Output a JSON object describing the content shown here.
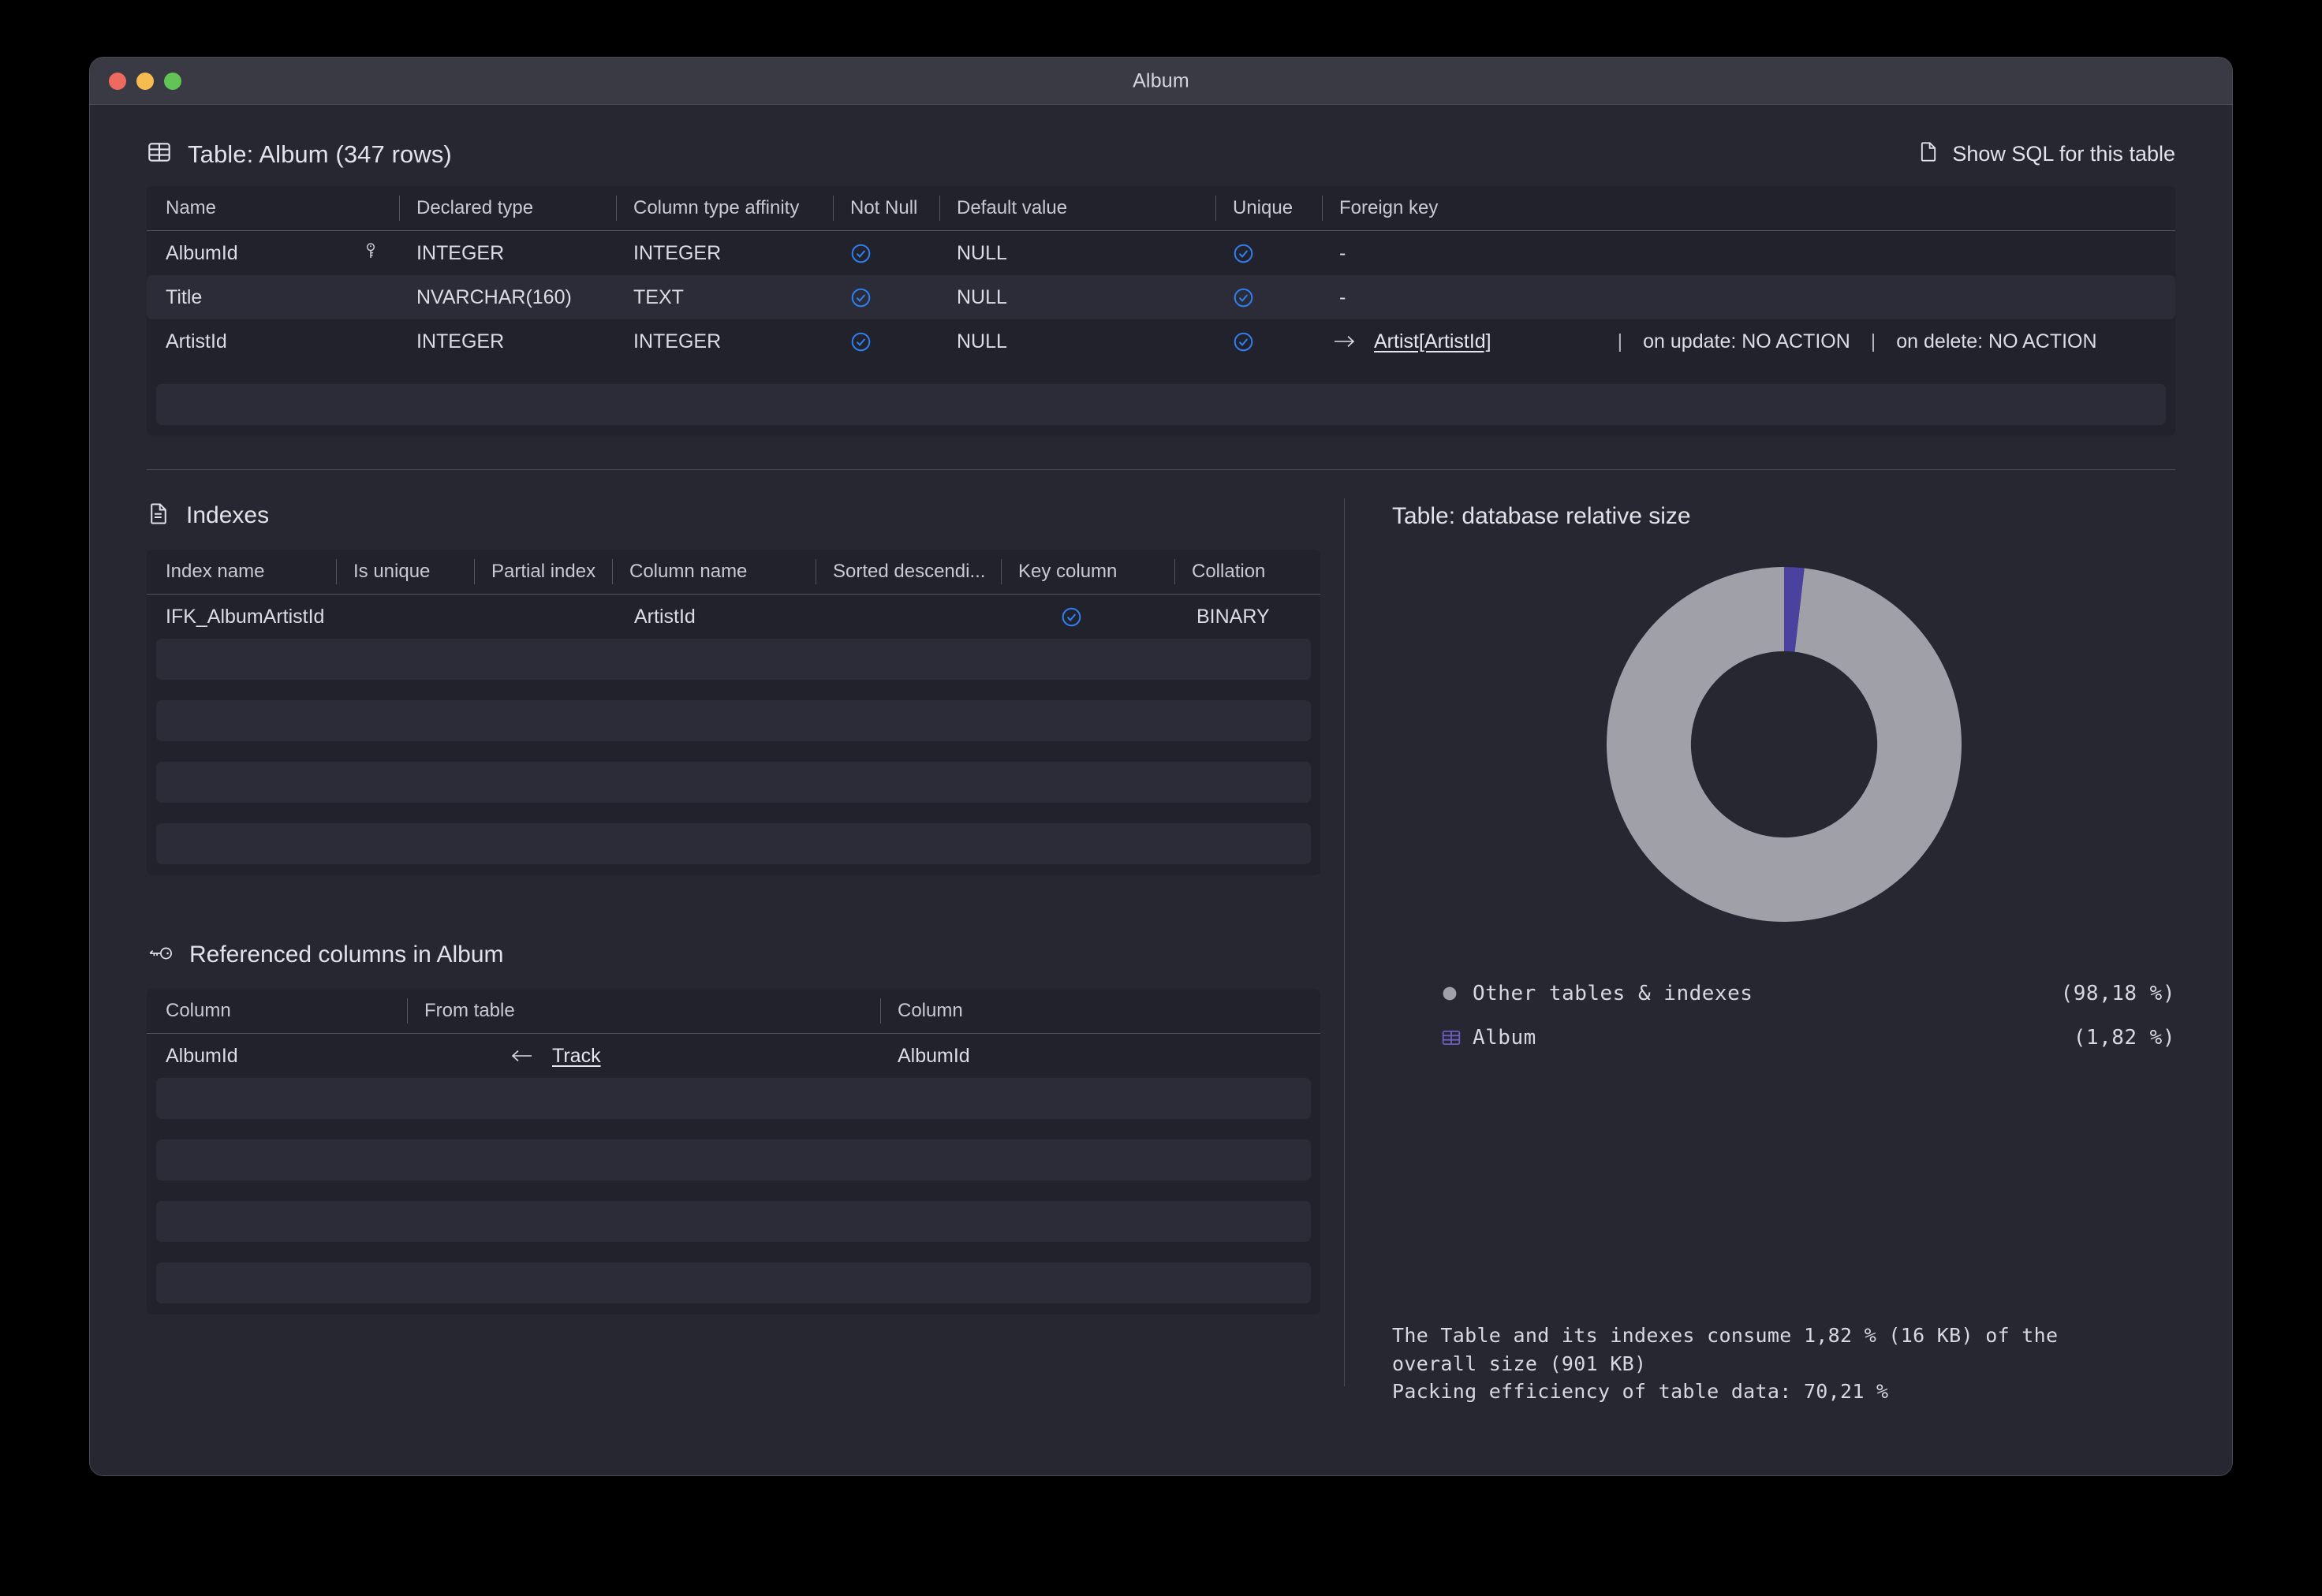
{
  "window": {
    "title": "Album"
  },
  "table_section": {
    "icon": "table-grid-icon",
    "title": "Table: Album (347 rows)",
    "show_sql_label": "Show SQL for this table",
    "show_sql_icon": "document-icon",
    "columns": [
      "Name",
      "Declared type",
      "Column type affinity",
      "Not Null",
      "Default value",
      "Unique",
      "Foreign key"
    ],
    "rows": [
      {
        "name": "AlbumId",
        "primary_key": true,
        "declared_type": "INTEGER",
        "affinity": "INTEGER",
        "not_null": true,
        "default_value": "NULL",
        "unique": true,
        "foreign_key": "-",
        "fk_target": "",
        "fk_on_update": "",
        "fk_on_delete": ""
      },
      {
        "name": "Title",
        "primary_key": false,
        "declared_type": "NVARCHAR(160)",
        "affinity": "TEXT",
        "not_null": true,
        "default_value": "NULL",
        "unique": true,
        "foreign_key": "-",
        "fk_target": "",
        "fk_on_update": "",
        "fk_on_delete": ""
      },
      {
        "name": "ArtistId",
        "primary_key": false,
        "declared_type": "INTEGER",
        "affinity": "INTEGER",
        "not_null": true,
        "default_value": "NULL",
        "unique": true,
        "foreign_key": "",
        "fk_target": "Artist[ArtistId]",
        "fk_on_update": "on update: NO ACTION",
        "fk_on_delete": "on delete: NO ACTION",
        "fk_separator": "|"
      }
    ]
  },
  "indexes_section": {
    "icon": "document-lines-icon",
    "title": "Indexes",
    "columns": [
      "Index name",
      "Is unique",
      "Partial index",
      "Column name",
      "Sorted descendi...",
      "Key column",
      "Collation"
    ],
    "rows": [
      {
        "index_name": "IFK_AlbumArtistId",
        "is_unique": "",
        "partial_index": "",
        "column_name": "ArtistId",
        "sorted_descending": "",
        "key_column": true,
        "collation": "BINARY"
      }
    ],
    "empty_row_count": 4
  },
  "referenced_section": {
    "icon": "key-horizontal-icon",
    "title": "Referenced columns in Album",
    "columns": [
      "Column",
      "From table",
      "Column"
    ],
    "rows": [
      {
        "column": "AlbumId",
        "arrow": "arrow-left-icon",
        "from_table": "Track",
        "target_column": "AlbumId"
      }
    ],
    "empty_row_count": 4
  },
  "size_section": {
    "title": "Table: database relative size",
    "legend": [
      {
        "icon": "circle-icon",
        "label": "Other tables & indexes",
        "percent": "(98,18 %)",
        "color": "#a0a0a8"
      },
      {
        "icon": "table-grid-icon",
        "label": "Album",
        "percent": "(1,82 %)",
        "color": "#4b42a0"
      }
    ],
    "summary_line1": "The Table and its indexes consume 1,82 % (16 KB) of the",
    "summary_line2": "overall size (901 KB)",
    "summary_line3": "Packing efficiency of table data: 70,21 %"
  },
  "chart_data": {
    "type": "pie",
    "title": "Table: database relative size",
    "donut": true,
    "labels": [
      "Other tables & indexes",
      "Album"
    ],
    "values": [
      98.18,
      1.82
    ],
    "value_labels": [
      "(98,18 %)",
      "(1,82 %)"
    ],
    "colors": [
      "#a0a0a8",
      "#4b42a0"
    ],
    "start_angle_deg": 0,
    "direction": "counterclockwise",
    "inner_radius_ratio": 0.525,
    "legend_position": "bottom",
    "units": "percent",
    "total_size": "901 KB",
    "table_size": "16 KB"
  },
  "colors": {
    "window_bg": "#272732",
    "titlebar_bg": "#3a3a45",
    "table_bg": "#22222c",
    "row_alt_bg": "#2c2c38",
    "accent_blue": "#2f7ff0",
    "text": "#e2e2e8",
    "muted_text": "#c9c9d2",
    "divider": "#4a4a57",
    "slice_grey": "#a0a0a8",
    "slice_purple": "#4b42a0"
  }
}
